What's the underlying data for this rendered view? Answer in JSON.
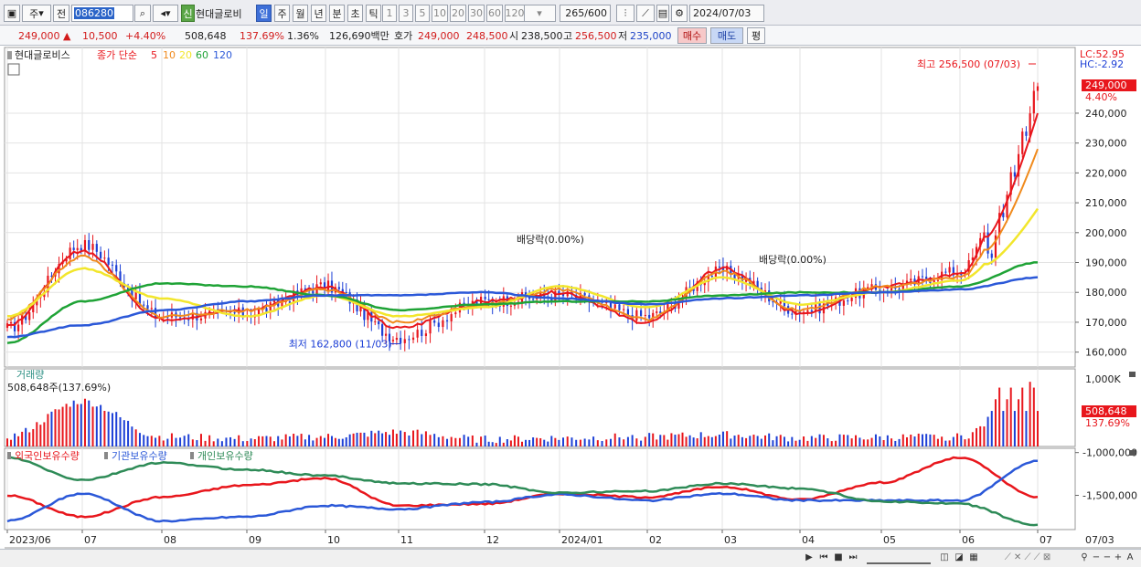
{
  "toolbar": {
    "period_main": "주",
    "prev_label": "전",
    "stock_code": "086280",
    "shin_label": "신",
    "stock_name": "현대글로비",
    "periods": [
      "일",
      "주",
      "월",
      "년",
      "분",
      "초",
      "틱"
    ],
    "active_period": "일",
    "intervals": [
      "1",
      "3",
      "5",
      "10",
      "20",
      "30",
      "60",
      "120"
    ],
    "count_display": "265",
    "count_total": "/600",
    "date": "2024/07/03"
  },
  "quote": {
    "price": "249,000",
    "change": "10,500",
    "change_pct": "+4.40%",
    "volume": "508,648",
    "volume_ratio": "137.69%",
    "turnover": "1.36%",
    "amount": "126,690백만",
    "bid_label": "호가",
    "bid": "249,000",
    "ask": "248,500",
    "open_label": "시",
    "open": "238,500",
    "high_label": "고",
    "high": "256,500",
    "low_label": "저",
    "low": "235,000",
    "buy_label": "매수",
    "sell_label": "매도",
    "eval_label": "평"
  },
  "colors": {
    "up": "#e8161c",
    "down": "#1c3fd6",
    "ma5": "#e8161c",
    "ma10": "#f08a1c",
    "ma20": "#f2e62c",
    "ma60": "#1fa336",
    "ma120": "#2b58d8",
    "foreign": "#e8161c",
    "institution": "#2b58d8",
    "individual": "#2e8b57"
  },
  "price_panel": {
    "legend_name": "현대글로비스",
    "legend_series": "종가 단순",
    "ma_labels": [
      "5",
      "10",
      "20",
      "60",
      "120"
    ],
    "lc_label": "LC:52.95",
    "hc_label": "HC:-2.92",
    "current_price_tag": "249,000",
    "current_pct_tag": "4.40%",
    "high_annotation": "최고 256,500 (07/03)",
    "low_annotation": "최저 162,800 (11/03)",
    "dividend_labels": [
      "배당락(0.00%)",
      "배당락(0.00%)"
    ]
  },
  "volume_panel": {
    "title": "거래량",
    "summary": "508,648주(137.69%)",
    "axis_label": "1,000K",
    "current_tag": "508,648",
    "current_pct_tag": "137.69%"
  },
  "holdings_panel": {
    "legend": [
      "외국인보유수량",
      "기관보유수량",
      "개인보유수량"
    ],
    "axis_labels": [
      "-1,000,000",
      "-1,500,000"
    ]
  },
  "x_labels": [
    "2023/06",
    "07",
    "08",
    "09",
    "10",
    "11",
    "12",
    "2024/01",
    "02",
    "03",
    "04",
    "05",
    "06",
    "07"
  ],
  "x_right_label": "07/03",
  "chart_data": {
    "type": "candlestick",
    "title": "",
    "xlabel": "",
    "ylabel": "",
    "ylim": [
      155000,
      262000
    ],
    "y_ticks": [
      "160,000",
      "170,000",
      "180,000",
      "190,000",
      "200,000",
      "210,000",
      "220,000",
      "230,000",
      "240,000"
    ],
    "x": [
      "2023-06",
      "2023-07",
      "2023-08",
      "2023-09",
      "2023-10",
      "2023-11",
      "2023-12",
      "2024-01",
      "2024-02",
      "2024-03",
      "2024-04",
      "2024-05",
      "2024-06",
      "2024-07"
    ],
    "series": [
      {
        "name": "종가",
        "values": [
          168000,
          196000,
          172000,
          173000,
          182000,
          165000,
          177000,
          179000,
          172000,
          187000,
          174000,
          181000,
          187000,
          249000
        ]
      },
      {
        "name": "5",
        "values": [
          169000,
          194000,
          171000,
          174000,
          182000,
          168000,
          177000,
          180000,
          170000,
          188000,
          173000,
          182000,
          186000,
          240000
        ]
      },
      {
        "name": "10",
        "values": [
          171000,
          192000,
          172000,
          174000,
          181000,
          170000,
          176000,
          181000,
          171000,
          187000,
          174000,
          182000,
          185000,
          228000
        ]
      },
      {
        "name": "20",
        "values": [
          172000,
          188000,
          178000,
          172000,
          179000,
          172000,
          175000,
          182000,
          175000,
          185000,
          176000,
          180000,
          184000,
          208000
        ]
      },
      {
        "name": "60",
        "values": [
          163000,
          177000,
          183000,
          182000,
          179000,
          174000,
          176000,
          177000,
          177000,
          179000,
          180000,
          180000,
          182000,
          190000
        ]
      },
      {
        "name": "120",
        "values": [
          165000,
          169000,
          174000,
          177000,
          179000,
          179000,
          180000,
          178000,
          176000,
          178000,
          179000,
          180000,
          181000,
          185000
        ]
      }
    ],
    "volume": [
      150000,
      700000,
      150000,
      120000,
      150000,
      220000,
      110000,
      130000,
      150000,
      180000,
      130000,
      140000,
      150000,
      1000000
    ],
    "holdings": [
      {
        "name": "외국인보유수량",
        "values": [
          -1500000,
          -1750000,
          -1520000,
          -1380000,
          -1300000,
          -1620000,
          -1600000,
          -1480000,
          -1520000,
          -1400000,
          -1550000,
          -1350000,
          -1060000,
          -1520000
        ]
      },
      {
        "name": "기관보유수량",
        "values": [
          -1800000,
          -1480000,
          -1800000,
          -1750000,
          -1620000,
          -1660000,
          -1580000,
          -1490000,
          -1560000,
          -1480000,
          -1560000,
          -1560000,
          -1560000,
          -1100000
        ]
      },
      {
        "name": "개인보유수량",
        "values": [
          -1060000,
          -1320000,
          -1120000,
          -1200000,
          -1270000,
          -1360000,
          -1370000,
          -1470000,
          -1450000,
          -1360000,
          -1420000,
          -1570000,
          -1600000,
          -1850000
        ]
      }
    ],
    "annotations": [
      {
        "label": "최고 256,500 (07/03)",
        "x": "2024-07",
        "y": 256500
      },
      {
        "label": "최저 162,800 (11/03)",
        "x": "2023-11",
        "y": 162800
      }
    ]
  }
}
